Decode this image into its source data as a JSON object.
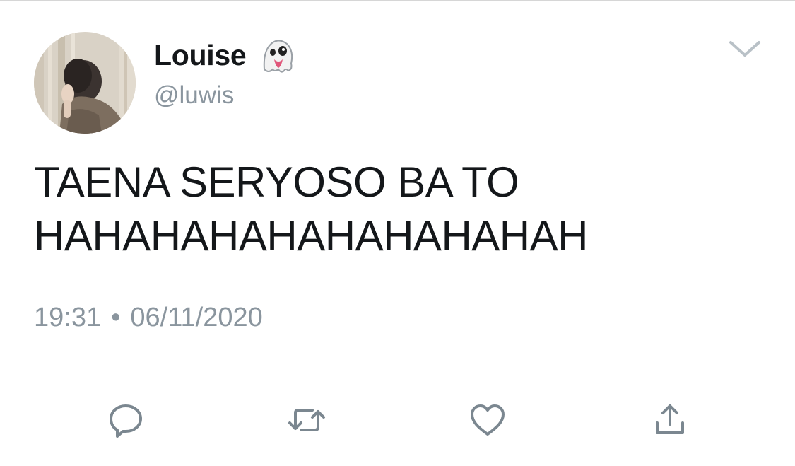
{
  "tweet": {
    "author": {
      "display_name": "Louise",
      "handle": "@luwis",
      "name_emoji_icon": "ghost-icon"
    },
    "text": "TAENA SERYOSO BA TO\nHAHAHAHAHAHAHAHAHAH",
    "time": "19:31",
    "separator": "•",
    "date": "06/11/2020"
  },
  "menu": {
    "icon": "chevron-down-icon"
  },
  "actions": [
    {
      "name": "reply",
      "icon": "reply-icon"
    },
    {
      "name": "retweet",
      "icon": "retweet-icon"
    },
    {
      "name": "like",
      "icon": "heart-icon"
    },
    {
      "name": "share",
      "icon": "share-icon"
    }
  ],
  "colors": {
    "text_primary": "#14171a",
    "text_secondary": "#8a959e",
    "icon": "#7b8790",
    "divider": "#cfd5d9"
  }
}
